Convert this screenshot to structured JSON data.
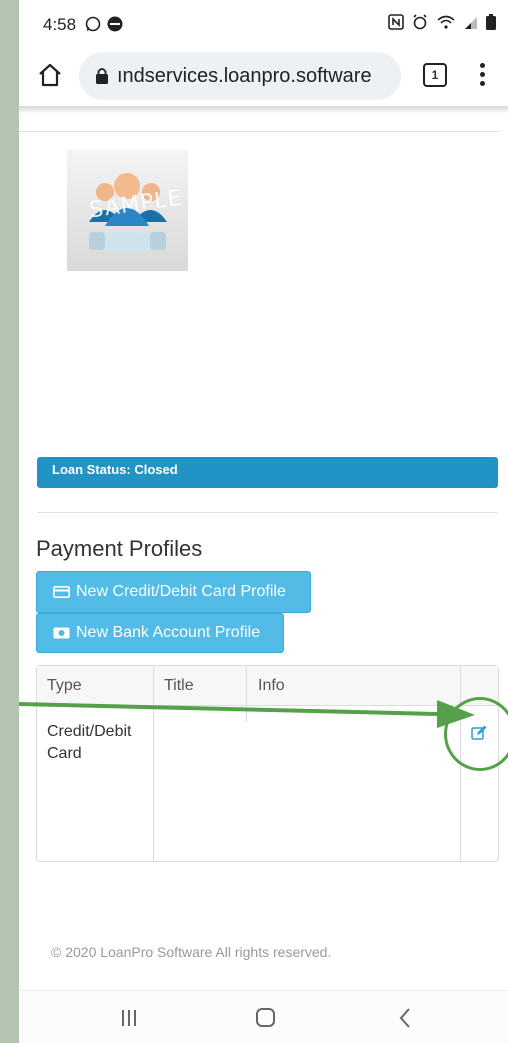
{
  "status_bar": {
    "time": "4:58",
    "icons": [
      "whatsapp-icon",
      "weather-badge-icon",
      "nfc-icon",
      "alarm-icon",
      "wifi-icon",
      "signal-icon",
      "battery-icon"
    ]
  },
  "browser": {
    "url": "ındservices.loanpro.software",
    "tab_count": "1",
    "icons": [
      "home-icon",
      "lock-icon",
      "kebab-menu-icon"
    ]
  },
  "profile": {
    "avatar_watermark": "SAMPLE"
  },
  "loan": {
    "status_label": "Loan Status: Closed"
  },
  "payment_profiles": {
    "title": "Payment Profiles",
    "new_card_button": "New Credit/Debit Card Profile",
    "new_bank_button": "New Bank Account Profile",
    "table": {
      "headers": [
        "Type",
        "Title",
        "Info",
        ""
      ],
      "rows": [
        {
          "type": "Credit/Debit Card",
          "title": "",
          "info": "",
          "action": "edit-icon"
        }
      ]
    }
  },
  "footer": {
    "copyright": "© 2020 LoanPro Software All rights reserved."
  },
  "colors": {
    "status_bar_blue": "#2193c5",
    "button_blue": "#52bbe6",
    "annotation_green": "#55a14a"
  }
}
